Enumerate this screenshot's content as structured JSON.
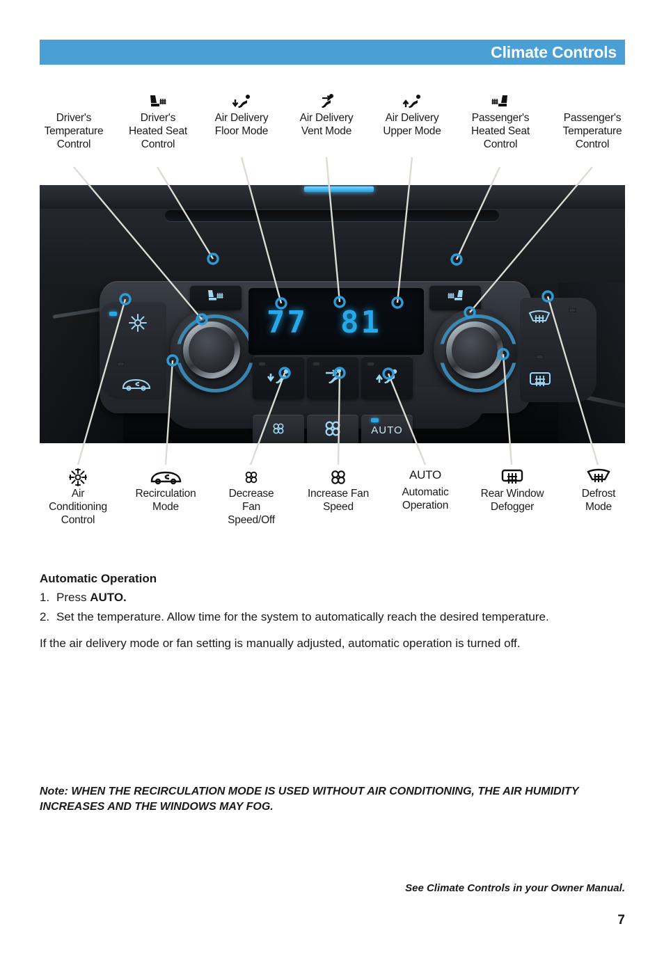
{
  "header": {
    "title": "Climate Controls"
  },
  "colors": {
    "header_bg": "#4a9fd4",
    "header_text": "#ffffff",
    "callout_dot": "#2d9cd6",
    "leader_line": "#dcdcd4",
    "display_segment": "#27a8e8",
    "panel_icon": "#9fd6f2"
  },
  "callouts_top": [
    {
      "label_line1": "Driver's",
      "label_line2": "Temperature",
      "label_line3": "Control",
      "icon": ""
    },
    {
      "label_line1": "Driver's",
      "label_line2": "Heated Seat",
      "label_line3": "Control",
      "icon": "heated-seat-icon"
    },
    {
      "label_line1": "Air Delivery",
      "label_line2": "Floor Mode",
      "label_line3": "",
      "icon": "air-delivery-floor-icon"
    },
    {
      "label_line1": "Air Delivery",
      "label_line2": "Vent Mode",
      "label_line3": "",
      "icon": "air-delivery-vent-icon"
    },
    {
      "label_line1": "Air Delivery",
      "label_line2": "Upper Mode",
      "label_line3": "",
      "icon": "air-delivery-upper-icon"
    },
    {
      "label_line1": "Passenger's",
      "label_line2": "Heated Seat",
      "label_line3": "Control",
      "icon": "heated-seat-icon"
    },
    {
      "label_line1": "Passenger's",
      "label_line2": "Temperature",
      "label_line3": "Control",
      "icon": ""
    }
  ],
  "callouts_bottom": [
    {
      "label_line1": "Air",
      "label_line2": "Conditioning",
      "label_line3": "Control",
      "icon": "snowflake-icon"
    },
    {
      "label_line1": "Recirculation",
      "label_line2": "Mode",
      "label_line3": "",
      "icon": "recirculation-icon"
    },
    {
      "label_line1": "Decrease",
      "label_line2": "Fan",
      "label_line3": "Speed/Off",
      "icon": "fan-small-icon"
    },
    {
      "label_line1": "Increase Fan",
      "label_line2": "Speed",
      "label_line3": "",
      "icon": "fan-large-icon"
    },
    {
      "label_line1": "AUTO",
      "label_line2": "Automatic",
      "label_line3": "Operation",
      "icon": "auto-text"
    },
    {
      "label_line1": "Rear Window",
      "label_line2": "Defogger",
      "label_line3": "",
      "icon": "rear-defogger-icon"
    },
    {
      "label_line1": "Defrost",
      "label_line2": "Mode",
      "label_line3": "",
      "icon": "defrost-icon"
    }
  ],
  "panel": {
    "display_driver_temp": "77",
    "display_passenger_temp": "81",
    "auto_button_label": "AUTO"
  },
  "body": {
    "heading": "Automatic Operation",
    "steps": [
      {
        "num": "1.",
        "text_before": "Press ",
        "text_bold": "AUTO.",
        "text_after": ""
      },
      {
        "num": "2.",
        "text_before": "Set the temperature. Allow time for the system to automatically reach the desired temperature.",
        "text_bold": "",
        "text_after": ""
      }
    ],
    "paragraph": "If the air delivery mode or fan setting is manually adjusted, automatic operation is turned off.",
    "note": "Note: WHEN THE RECIRCULATION MODE IS USED WITHOUT AIR CONDITIONING, THE AIR HUMIDITY INCREASES AND THE WINDOWS MAY FOG."
  },
  "footer": {
    "reference": "See Climate Controls in your Owner Manual.",
    "page_number": "7"
  }
}
